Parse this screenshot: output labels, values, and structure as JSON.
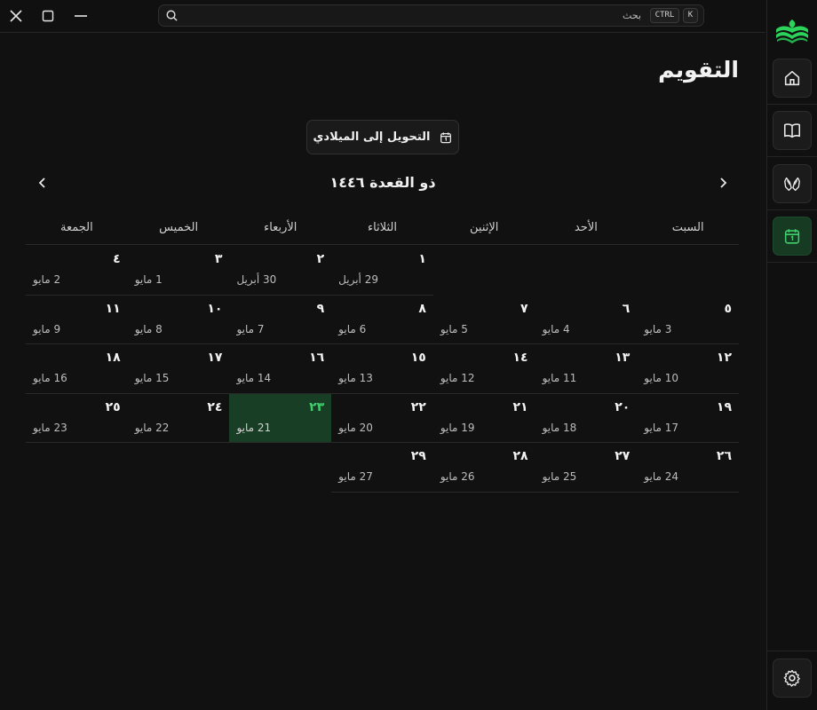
{
  "window": {
    "close_icon": "close-icon",
    "maximize_icon": "maximize-icon",
    "minimize_icon": "minimize-icon"
  },
  "search": {
    "placeholder": "بحث",
    "shortcut_ctrl": "CTRL",
    "shortcut_key": "K"
  },
  "sidebar": {
    "items": [
      {
        "name": "home",
        "icon": "home-icon"
      },
      {
        "name": "quran",
        "icon": "book-icon"
      },
      {
        "name": "duas",
        "icon": "praying-hands-icon"
      },
      {
        "name": "calendar",
        "icon": "calendar-icon",
        "active": true
      }
    ],
    "settings_icon": "gear-icon"
  },
  "colors": {
    "accent": "#3ecf6d",
    "today_bg": "#183e25",
    "background": "#111111"
  },
  "page": {
    "title": "التقويم"
  },
  "convert_button": {
    "label": "التحويل إلى الميلادي"
  },
  "calendar": {
    "month_title": "ذو القعدة ١٤٤٦",
    "weekdays": [
      "السبت",
      "الأحد",
      "الإثنين",
      "الثلاثاء",
      "الأربعاء",
      "الخميس",
      "الجمعة"
    ],
    "today_index": 25,
    "cells": [
      null,
      null,
      null,
      {
        "h": "١",
        "g": "29 أبريل"
      },
      {
        "h": "٢",
        "g": "30 أبريل"
      },
      {
        "h": "٣",
        "g": "1 مايو"
      },
      {
        "h": "٤",
        "g": "2 مايو"
      },
      {
        "h": "٥",
        "g": "3 مايو"
      },
      {
        "h": "٦",
        "g": "4 مايو"
      },
      {
        "h": "٧",
        "g": "5 مايو"
      },
      {
        "h": "٨",
        "g": "6 مايو"
      },
      {
        "h": "٩",
        "g": "7 مايو"
      },
      {
        "h": "١٠",
        "g": "8 مايو"
      },
      {
        "h": "١١",
        "g": "9 مايو"
      },
      {
        "h": "١٢",
        "g": "10 مايو"
      },
      {
        "h": "١٣",
        "g": "11 مايو"
      },
      {
        "h": "١٤",
        "g": "12 مايو"
      },
      {
        "h": "١٥",
        "g": "13 مايو"
      },
      {
        "h": "١٦",
        "g": "14 مايو"
      },
      {
        "h": "١٧",
        "g": "15 مايو"
      },
      {
        "h": "١٨",
        "g": "16 مايو"
      },
      {
        "h": "١٩",
        "g": "17 مايو"
      },
      {
        "h": "٢٠",
        "g": "18 مايو"
      },
      {
        "h": "٢١",
        "g": "19 مايو"
      },
      {
        "h": "٢٢",
        "g": "20 مايو"
      },
      {
        "h": "٢٣",
        "g": "21 مايو"
      },
      {
        "h": "٢٤",
        "g": "22 مايو"
      },
      {
        "h": "٢٥",
        "g": "23 مايو"
      },
      {
        "h": "٢٦",
        "g": "24 مايو"
      },
      {
        "h": "٢٧",
        "g": "25 مايو"
      },
      {
        "h": "٢٨",
        "g": "26 مايو"
      },
      {
        "h": "٢٩",
        "g": "27 مايو"
      }
    ]
  }
}
